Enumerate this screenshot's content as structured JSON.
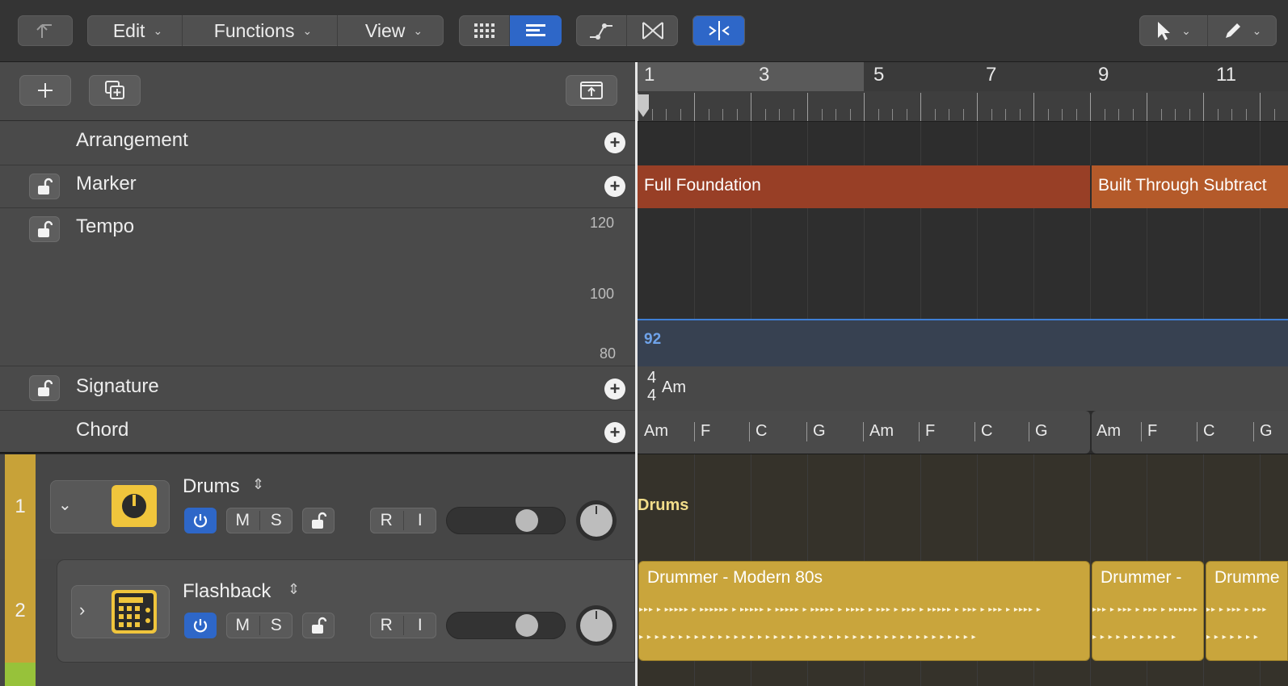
{
  "toolbar": {
    "menus": [
      {
        "label": "Edit"
      },
      {
        "label": "Functions"
      },
      {
        "label": "View"
      }
    ]
  },
  "global_tracks": {
    "arrangement": {
      "label": "Arrangement"
    },
    "marker": {
      "label": "Marker"
    },
    "tempo": {
      "label": "Tempo",
      "scale": [
        "120",
        "100",
        "80"
      ],
      "value": "92"
    },
    "signature": {
      "label": "Signature",
      "time_sig_top": "4",
      "time_sig_bottom": "4",
      "key": "Am"
    },
    "chord": {
      "label": "Chord"
    }
  },
  "ruler": {
    "bars": [
      "1",
      "3",
      "5",
      "7",
      "9",
      "11"
    ]
  },
  "markers": [
    {
      "name": "Full Foundation",
      "color": "#983f26"
    },
    {
      "name": "Built Through Subtract",
      "color": "#b45a2a"
    }
  ],
  "chords": [
    "Am",
    "F",
    "C",
    "G",
    "Am",
    "F",
    "C",
    "G",
    "Am",
    "F",
    "C",
    "G"
  ],
  "tracks": [
    {
      "number": "1",
      "name": "Drums",
      "region_label": "Drums",
      "buttons": {
        "mute": "M",
        "solo": "S",
        "record": "R",
        "input": "I"
      }
    },
    {
      "number": "2",
      "name": "Flashback",
      "buttons": {
        "mute": "M",
        "solo": "S",
        "record": "R",
        "input": "I"
      },
      "regions": [
        {
          "title": "Drummer - Modern 80s"
        },
        {
          "title": "Drummer -"
        },
        {
          "title": "Drumme"
        }
      ]
    }
  ],
  "colors": {
    "accent": "#2e67c8",
    "drummer_region": "#c9a53c",
    "track_color": "#c8a238"
  }
}
